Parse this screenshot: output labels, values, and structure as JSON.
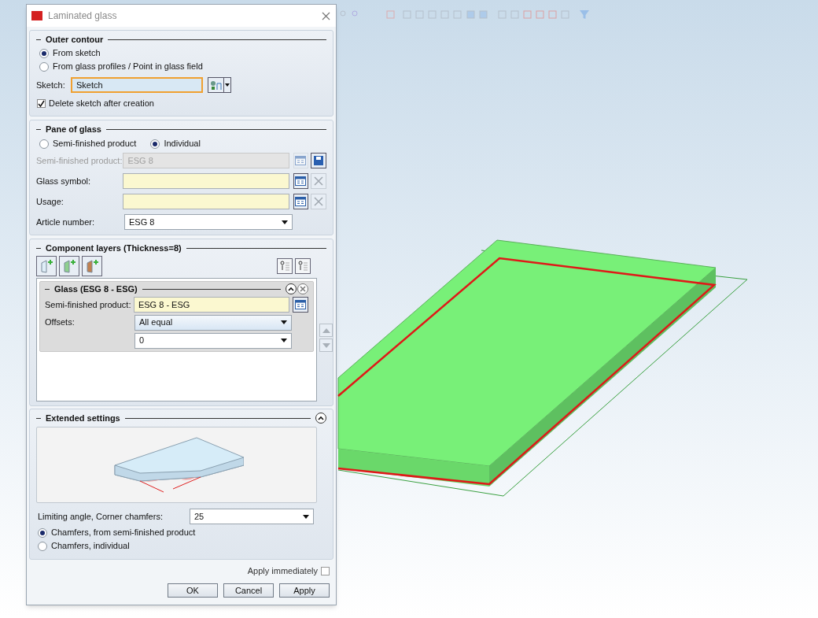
{
  "window": {
    "title": "Laminated glass"
  },
  "outer_contour": {
    "title": "Outer contour",
    "options": [
      {
        "label": "From sketch",
        "selected": true
      },
      {
        "label": "From glass profiles / Point in glass field",
        "selected": false
      }
    ],
    "sketch_label": "Sketch:",
    "sketch_value": "Sketch",
    "delete_sketch": {
      "label": "Delete sketch after creation",
      "checked": true
    }
  },
  "pane_of_glass": {
    "title": "Pane of glass",
    "options": [
      {
        "label": "Semi-finished product",
        "selected": false
      },
      {
        "label": "Individual",
        "selected": true
      }
    ],
    "fields": [
      {
        "kind": "lookup",
        "label": "Semi-finished product:",
        "value": "ESG 8",
        "disabled": true
      },
      {
        "kind": "lookup",
        "label": "Glass symbol:",
        "disabled": false
      },
      {
        "kind": "lookup",
        "label": "Usage:",
        "disabled": false
      },
      {
        "kind": "select",
        "label": "Article number:",
        "value": "ESG 8",
        "disabled": false
      }
    ]
  },
  "component_layers": {
    "title": "Component layers (Thickness=8)",
    "layers": [
      {
        "title": "Glass (ESG 8 - ESG)",
        "semi_label": "Semi-finished product:",
        "semi_value": "ESG 8 - ESG",
        "offsets_label": "Offsets:",
        "offsets_value": "All equal",
        "offset_amount": "0"
      }
    ]
  },
  "extended_settings": {
    "title": "Extended settings",
    "angle_label": "Limiting angle, Corner chamfers:",
    "angle_value": "25",
    "options": [
      {
        "label": "Chamfers, from semi-finished product",
        "selected": true
      },
      {
        "label": "Chamfers, individual",
        "selected": false
      }
    ]
  },
  "apply_immediately": {
    "label": "Apply immediately",
    "checked": false
  },
  "buttons": [
    "OK",
    "Cancel",
    "Apply"
  ]
}
